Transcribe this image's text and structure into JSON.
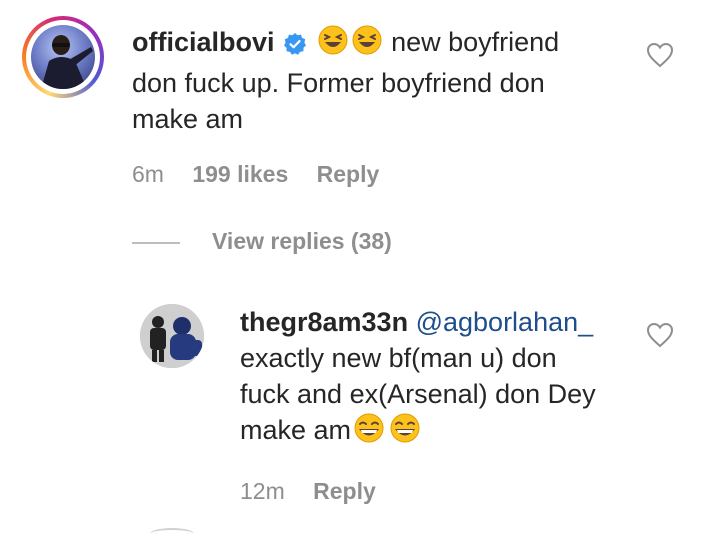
{
  "comments": [
    {
      "username": "officialbovi",
      "verified": true,
      "text_line1": "new boyfriend",
      "text_line2": "don fuck up. Former boyfriend don",
      "text_line3": "make am",
      "time": "6m",
      "likes": "199 likes",
      "reply_label": "Reply",
      "view_replies": "View replies (38)"
    },
    {
      "username": "thegr8am33n",
      "mention": "@agborlahan_",
      "text_line1": "exactly new bf(man u) don",
      "text_line2": "fuck and ex(Arsenal) don Dey",
      "text_line3": "make am",
      "time": "12m",
      "reply_label": "Reply"
    }
  ],
  "icons": {
    "verified": "verified-badge-icon",
    "heart": "heart-outline-icon",
    "emoji_laugh_squint": "squinting-laugh-emoji",
    "emoji_grin": "grinning-squint-emoji"
  },
  "colors": {
    "text": "#262626",
    "muted": "#8e8e8e",
    "verified_blue": "#3897f0",
    "mention": "#1f4e8c",
    "emoji_yellow": "#fcc21b"
  }
}
